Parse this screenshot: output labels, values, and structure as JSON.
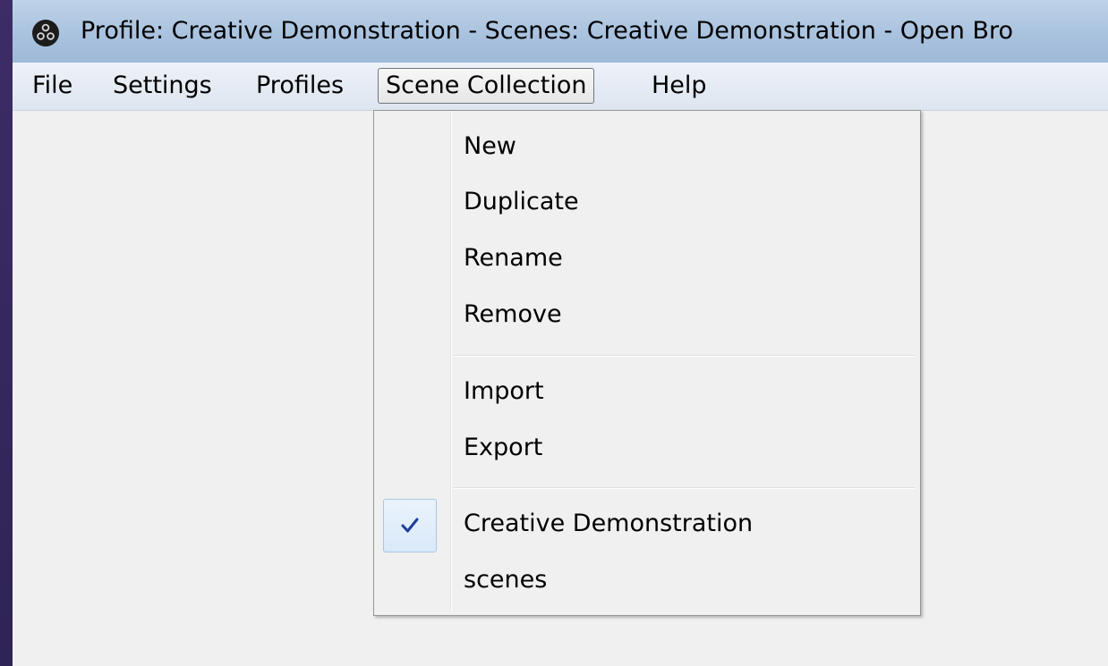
{
  "window": {
    "title": "Profile: Creative Demonstration - Scenes: Creative Demonstration - Open Bro"
  },
  "menubar": {
    "items": [
      {
        "label": "File"
      },
      {
        "label": "Settings"
      },
      {
        "label": "Profiles"
      },
      {
        "label": "Scene Collection",
        "active": true
      },
      {
        "label": "Help"
      }
    ]
  },
  "scene_collection_menu": {
    "items": [
      {
        "label": "New"
      },
      {
        "label": "Duplicate"
      },
      {
        "label": "Rename"
      },
      {
        "label": "Remove"
      },
      {
        "label": "Import"
      },
      {
        "label": "Export"
      },
      {
        "label": "Creative Demonstration",
        "checked": true
      },
      {
        "label": "scenes"
      }
    ]
  },
  "icons": {
    "app": "obs-logo-icon",
    "checked": "checkmark-icon"
  },
  "colors": {
    "desktop": "#3a2d62",
    "titlebar": "#a9c2de",
    "menu_bg": "#f0f0f0",
    "check_highlight": "#d9e9f9",
    "checkmark": "#1f3d9a"
  }
}
